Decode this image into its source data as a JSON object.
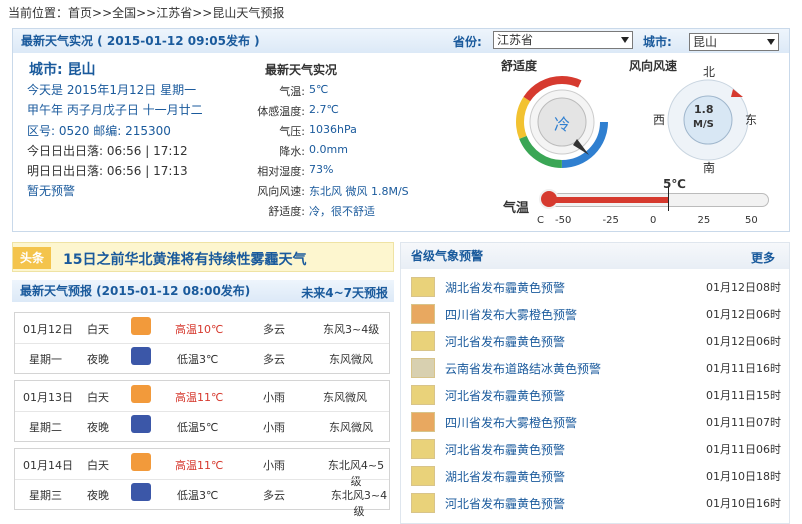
{
  "breadcrumb": {
    "prefix": "当前位置：",
    "path": "首页>>全国>>江苏省>>昆山天气预报"
  },
  "live": {
    "header": "最新天气实况 ( 2015-01-12 09:05发布 )",
    "province_label": "省份:",
    "province_value": "江苏省",
    "city_label": "城市:",
    "city_value": "昆山",
    "city_title": "城市: 昆山",
    "today_line": "今天是 2015年1月12日 星期一",
    "lunar_line": "甲午年 丙子月戊子日 十一月廿二",
    "area_line": "区号: 0520  邮编: 215300",
    "sun_today": "今日日出日落: 06:56 | 17:12",
    "sun_tomorrow": "明日日出日落: 06:56 | 17:13",
    "no_warning": "暂无预警",
    "obs_title": "最新天气实况",
    "obs": [
      {
        "k": "气温:",
        "v": "5℃"
      },
      {
        "k": "体感温度:",
        "v": "2.7℃"
      },
      {
        "k": "气压:",
        "v": "1036hPa"
      },
      {
        "k": "降水:",
        "v": "0.0mm"
      },
      {
        "k": "相对湿度:",
        "v": "73%"
      },
      {
        "k": "风向风速:",
        "v": "东北风 微风 1.8M/S"
      },
      {
        "k": "舒适度:",
        "v": "冷，很不舒适"
      }
    ],
    "comfort_title": "舒适度",
    "comfort_value": "冷",
    "wind_title": "风向风速",
    "wind_value": "1.8",
    "wind_unit": "M/S",
    "compass": {
      "n": "北",
      "s": "南",
      "e": "东",
      "w": "西"
    },
    "temp_label": "气温",
    "temp_value_label": "5℃",
    "temp_value": 5,
    "temp_ticks": [
      "-50",
      "-25",
      "0",
      "25",
      "50"
    ],
    "temp_unit": "C"
  },
  "news": {
    "tag": "头条",
    "title": "15日之前华北黄淮将有持续性雾霾天气"
  },
  "forecast": {
    "header": "最新天气预报 (2015-01-12 08:00发布)",
    "future_link": "未来4~7天预报",
    "days": [
      {
        "date": "01月12日",
        "week": "星期一",
        "day_lbl": "白天",
        "night_lbl": "夜晚",
        "day_temp": "高温10℃",
        "night_temp": "低温3℃",
        "day_wx": "多云",
        "night_wx": "多云",
        "day_wind": "东风3~4级",
        "night_wind": "东风微风"
      },
      {
        "date": "01月13日",
        "week": "星期二",
        "day_lbl": "白天",
        "night_lbl": "夜晚",
        "day_temp": "高温11℃",
        "night_temp": "低温5℃",
        "day_wx": "小雨",
        "night_wx": "小雨",
        "day_wind": "东风微风",
        "night_wind": "东风微风"
      },
      {
        "date": "01月14日",
        "week": "星期三",
        "day_lbl": "白天",
        "night_lbl": "夜晚",
        "day_temp": "高温11℃",
        "night_temp": "低温3℃",
        "day_wx": "小雨",
        "night_wx": "多云",
        "day_wind": "东北风4~5级",
        "night_wind": "东北风3~4级"
      }
    ]
  },
  "warnings": {
    "header": "省级气象预警",
    "more": "更多",
    "items": [
      {
        "text": "湖北省发布霾黄色预警",
        "time": "01月12日08时",
        "color": "#e9d27a"
      },
      {
        "text": "四川省发布大雾橙色预警",
        "time": "01月12日06时",
        "color": "#e8a860"
      },
      {
        "text": "河北省发布霾黄色预警",
        "time": "01月12日06时",
        "color": "#e9d27a"
      },
      {
        "text": "云南省发布道路结冰黄色预警",
        "time": "01月11日16时",
        "color": "#d8d0b0"
      },
      {
        "text": "河北省发布霾黄色预警",
        "time": "01月11日15时",
        "color": "#e9d27a"
      },
      {
        "text": "四川省发布大雾橙色预警",
        "time": "01月11日07时",
        "color": "#e8a860"
      },
      {
        "text": "河北省发布霾黄色预警",
        "time": "01月11日06时",
        "color": "#e9d27a"
      },
      {
        "text": "湖北省发布霾黄色预警",
        "time": "01月10日18时",
        "color": "#e9d27a"
      },
      {
        "text": "河北省发布霾黄色预警",
        "time": "01月10日16时",
        "color": "#e9d27a"
      }
    ]
  }
}
